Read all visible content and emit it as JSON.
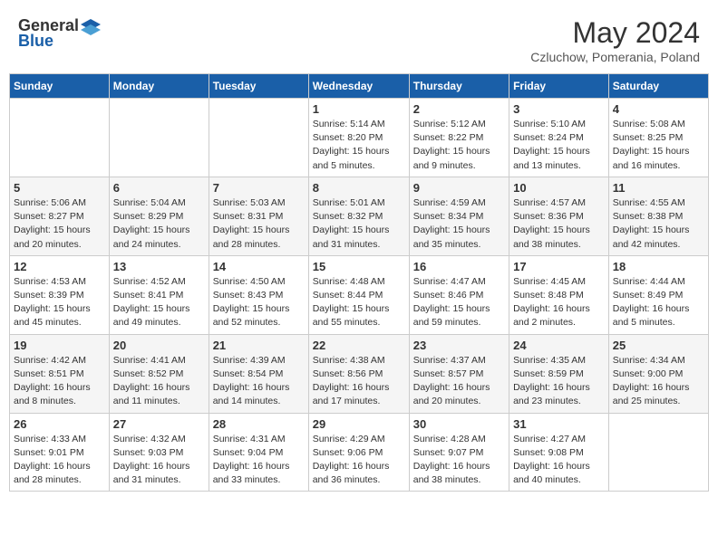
{
  "header": {
    "logo_general": "General",
    "logo_blue": "Blue",
    "month_title": "May 2024",
    "subtitle": "Czluchow, Pomerania, Poland"
  },
  "days_of_week": [
    "Sunday",
    "Monday",
    "Tuesday",
    "Wednesday",
    "Thursday",
    "Friday",
    "Saturday"
  ],
  "weeks": [
    [
      {
        "day": "",
        "info": ""
      },
      {
        "day": "",
        "info": ""
      },
      {
        "day": "",
        "info": ""
      },
      {
        "day": "1",
        "info": "Sunrise: 5:14 AM\nSunset: 8:20 PM\nDaylight: 15 hours and 5 minutes."
      },
      {
        "day": "2",
        "info": "Sunrise: 5:12 AM\nSunset: 8:22 PM\nDaylight: 15 hours and 9 minutes."
      },
      {
        "day": "3",
        "info": "Sunrise: 5:10 AM\nSunset: 8:24 PM\nDaylight: 15 hours and 13 minutes."
      },
      {
        "day": "4",
        "info": "Sunrise: 5:08 AM\nSunset: 8:25 PM\nDaylight: 15 hours and 16 minutes."
      }
    ],
    [
      {
        "day": "5",
        "info": "Sunrise: 5:06 AM\nSunset: 8:27 PM\nDaylight: 15 hours and 20 minutes."
      },
      {
        "day": "6",
        "info": "Sunrise: 5:04 AM\nSunset: 8:29 PM\nDaylight: 15 hours and 24 minutes."
      },
      {
        "day": "7",
        "info": "Sunrise: 5:03 AM\nSunset: 8:31 PM\nDaylight: 15 hours and 28 minutes."
      },
      {
        "day": "8",
        "info": "Sunrise: 5:01 AM\nSunset: 8:32 PM\nDaylight: 15 hours and 31 minutes."
      },
      {
        "day": "9",
        "info": "Sunrise: 4:59 AM\nSunset: 8:34 PM\nDaylight: 15 hours and 35 minutes."
      },
      {
        "day": "10",
        "info": "Sunrise: 4:57 AM\nSunset: 8:36 PM\nDaylight: 15 hours and 38 minutes."
      },
      {
        "day": "11",
        "info": "Sunrise: 4:55 AM\nSunset: 8:38 PM\nDaylight: 15 hours and 42 minutes."
      }
    ],
    [
      {
        "day": "12",
        "info": "Sunrise: 4:53 AM\nSunset: 8:39 PM\nDaylight: 15 hours and 45 minutes."
      },
      {
        "day": "13",
        "info": "Sunrise: 4:52 AM\nSunset: 8:41 PM\nDaylight: 15 hours and 49 minutes."
      },
      {
        "day": "14",
        "info": "Sunrise: 4:50 AM\nSunset: 8:43 PM\nDaylight: 15 hours and 52 minutes."
      },
      {
        "day": "15",
        "info": "Sunrise: 4:48 AM\nSunset: 8:44 PM\nDaylight: 15 hours and 55 minutes."
      },
      {
        "day": "16",
        "info": "Sunrise: 4:47 AM\nSunset: 8:46 PM\nDaylight: 15 hours and 59 minutes."
      },
      {
        "day": "17",
        "info": "Sunrise: 4:45 AM\nSunset: 8:48 PM\nDaylight: 16 hours and 2 minutes."
      },
      {
        "day": "18",
        "info": "Sunrise: 4:44 AM\nSunset: 8:49 PM\nDaylight: 16 hours and 5 minutes."
      }
    ],
    [
      {
        "day": "19",
        "info": "Sunrise: 4:42 AM\nSunset: 8:51 PM\nDaylight: 16 hours and 8 minutes."
      },
      {
        "day": "20",
        "info": "Sunrise: 4:41 AM\nSunset: 8:52 PM\nDaylight: 16 hours and 11 minutes."
      },
      {
        "day": "21",
        "info": "Sunrise: 4:39 AM\nSunset: 8:54 PM\nDaylight: 16 hours and 14 minutes."
      },
      {
        "day": "22",
        "info": "Sunrise: 4:38 AM\nSunset: 8:56 PM\nDaylight: 16 hours and 17 minutes."
      },
      {
        "day": "23",
        "info": "Sunrise: 4:37 AM\nSunset: 8:57 PM\nDaylight: 16 hours and 20 minutes."
      },
      {
        "day": "24",
        "info": "Sunrise: 4:35 AM\nSunset: 8:59 PM\nDaylight: 16 hours and 23 minutes."
      },
      {
        "day": "25",
        "info": "Sunrise: 4:34 AM\nSunset: 9:00 PM\nDaylight: 16 hours and 25 minutes."
      }
    ],
    [
      {
        "day": "26",
        "info": "Sunrise: 4:33 AM\nSunset: 9:01 PM\nDaylight: 16 hours and 28 minutes."
      },
      {
        "day": "27",
        "info": "Sunrise: 4:32 AM\nSunset: 9:03 PM\nDaylight: 16 hours and 31 minutes."
      },
      {
        "day": "28",
        "info": "Sunrise: 4:31 AM\nSunset: 9:04 PM\nDaylight: 16 hours and 33 minutes."
      },
      {
        "day": "29",
        "info": "Sunrise: 4:29 AM\nSunset: 9:06 PM\nDaylight: 16 hours and 36 minutes."
      },
      {
        "day": "30",
        "info": "Sunrise: 4:28 AM\nSunset: 9:07 PM\nDaylight: 16 hours and 38 minutes."
      },
      {
        "day": "31",
        "info": "Sunrise: 4:27 AM\nSunset: 9:08 PM\nDaylight: 16 hours and 40 minutes."
      },
      {
        "day": "",
        "info": ""
      }
    ]
  ]
}
